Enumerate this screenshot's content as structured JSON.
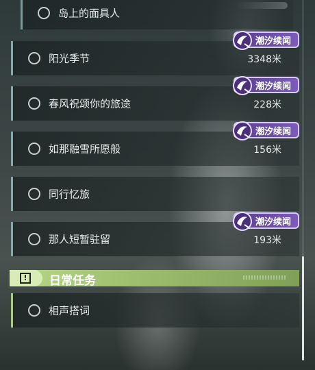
{
  "quests": [
    {
      "title": "岛上的面具人",
      "tag": "",
      "distance": ""
    },
    {
      "title": "阳光季节",
      "tag": "潮汐续闻",
      "distance": "3348米"
    },
    {
      "title": "春风祝颂你的旅途",
      "tag": "潮汐续闻",
      "distance": "228米"
    },
    {
      "title": "如那融雪所愿般",
      "tag": "潮汐续闻",
      "distance": "156米"
    },
    {
      "title": "同行忆旅",
      "tag": "",
      "distance": ""
    },
    {
      "title": "那人短暂驻留",
      "tag": "潮汐续闻",
      "distance": "193米"
    }
  ],
  "daily_section": {
    "title": "日常任务",
    "icon": "exclamation-icon",
    "quests": [
      {
        "title": "相声搭词"
      }
    ]
  },
  "colors": {
    "tag_purple": "#7b5cb8",
    "section_green": "#b8d88a"
  },
  "icons": {
    "tag_icon": "tide-swirl-icon",
    "radio": "empty-circle-icon"
  }
}
